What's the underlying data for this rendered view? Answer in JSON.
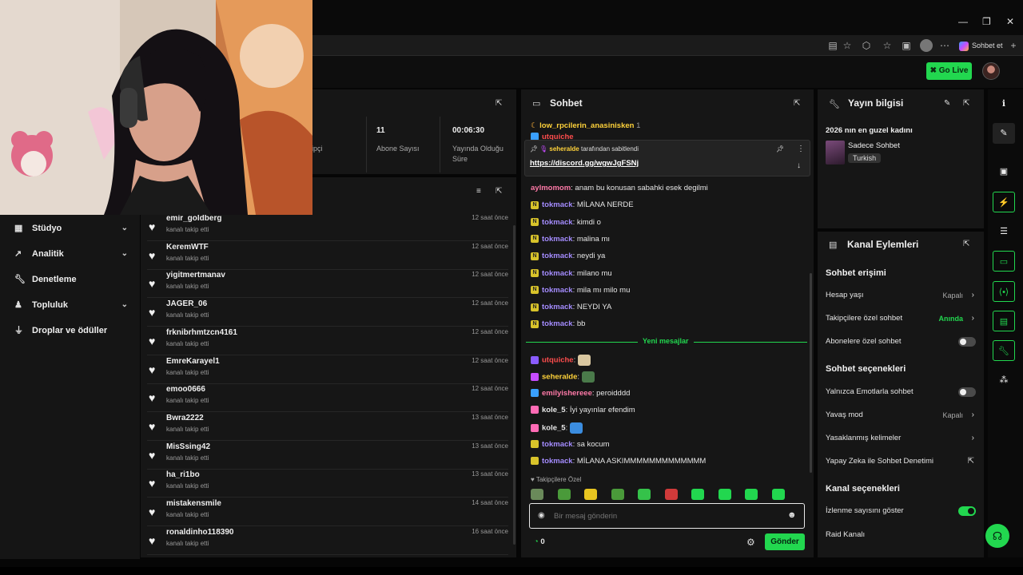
{
  "browser": {
    "window_controls": [
      "—",
      "❐",
      "✕"
    ],
    "copilot_label": "Sohbet et"
  },
  "topbar": {
    "go_live": "Go Live"
  },
  "nav": [
    {
      "label": "Stüdyo",
      "icon": "studio-icon",
      "expandable": true
    },
    {
      "label": "Analitik",
      "icon": "analytics-icon",
      "expandable": true
    },
    {
      "label": "Denetleme",
      "icon": "wrench-icon",
      "expandable": false
    },
    {
      "label": "Topluluk",
      "icon": "community-icon",
      "expandable": true
    },
    {
      "label": "Droplar ve ödüller",
      "icon": "drops-icon",
      "expandable": false
    }
  ],
  "stats": {
    "partial_label": "ipçi",
    "subs_value": "11",
    "subs_label": "Abone Sayısı",
    "time_value": "00:06:30",
    "time_label": "Yayında Olduğu Süre"
  },
  "followers": [
    {
      "name": "emir_goldberg",
      "action": "kanalı takip etti",
      "time": "12 saat önce"
    },
    {
      "name": "KeremWTF",
      "action": "kanalı takip etti",
      "time": "12 saat önce"
    },
    {
      "name": "yigitmertmanav",
      "action": "kanalı takip etti",
      "time": "12 saat önce"
    },
    {
      "name": "JAGER_06",
      "action": "kanalı takip etti",
      "time": "12 saat önce"
    },
    {
      "name": "frknibrhmtzcn4161",
      "action": "kanalı takip etti",
      "time": "12 saat önce"
    },
    {
      "name": "EmreKarayel1",
      "action": "kanalı takip etti",
      "time": "12 saat önce"
    },
    {
      "name": "emoo0666",
      "action": "kanalı takip etti",
      "time": "12 saat önce"
    },
    {
      "name": "Bwra2222",
      "action": "kanalı takip etti",
      "time": "13 saat önce"
    },
    {
      "name": "MisSsing42",
      "action": "kanalı takip etti",
      "time": "13 saat önce"
    },
    {
      "name": "ha_ri1bo",
      "action": "kanalı takip etti",
      "time": "13 saat önce"
    },
    {
      "name": "mistakensmile",
      "action": "kanalı takip etti",
      "time": "14 saat önce"
    },
    {
      "name": "ronaldinho118390",
      "action": "kanalı takip etti",
      "time": "16 saat önce"
    }
  ],
  "chat": {
    "title": "Sohbet",
    "top_user": "low_rpcilerin_anasinisken",
    "top_count": "1",
    "partial_user": "utquiche",
    "pinned_by_user": "seheralde",
    "pinned_by_text": "tarafından sabitlendi",
    "pinned_link": "https://discord.gg/wgwJgFSNj",
    "messages": [
      {
        "user": "aylmomom",
        "text": ": anam bu konusan sabahki esek degilmi",
        "color": "#ff7aa8",
        "badge": false
      },
      {
        "user": "tokmack",
        "text": ": MİLANA NERDE",
        "color": "#a48cff",
        "badge": true
      },
      {
        "user": "tokmack",
        "text": ": kimdi o",
        "color": "#a48cff",
        "badge": true
      },
      {
        "user": "tokmack",
        "text": ": malina mı",
        "color": "#a48cff",
        "badge": true
      },
      {
        "user": "tokmack",
        "text": ": neydi ya",
        "color": "#a48cff",
        "badge": true
      },
      {
        "user": "tokmack",
        "text": ": milano mu",
        "color": "#a48cff",
        "badge": true
      },
      {
        "user": "tokmack",
        "text": ": mila mı milo mu",
        "color": "#a48cff",
        "badge": true
      },
      {
        "user": "tokmack",
        "text": ": NEYDI YA",
        "color": "#a48cff",
        "badge": true
      },
      {
        "user": "tokmack",
        "text": ": bb",
        "color": "#a48cff",
        "badge": true
      }
    ],
    "new_messages": "Yeni mesajlar",
    "messages2": [
      {
        "user": "utquiche",
        "text": ":",
        "color": "#ff4d4d",
        "emote": "#d9c7a0"
      },
      {
        "user": "seheralde",
        "text": ":",
        "color": "#ffd23a",
        "emote": "#4a7a4a"
      },
      {
        "user": "emilyishereee",
        "text": ": peroidddd",
        "color": "#ff7aa8",
        "emote": ""
      },
      {
        "user": "kole_5",
        "text": ": İyi yayınlar efendim",
        "color": "#e6e6e6",
        "emote": ""
      },
      {
        "user": "kole_5",
        "text": ":",
        "color": "#e6e6e6",
        "emote": "#3b8de0"
      },
      {
        "user": "tokmack",
        "text": ": sa kocum",
        "color": "#a48cff",
        "emote": ""
      },
      {
        "user": "tokmack",
        "text": ": MİLANA ASKIMMMMMMMMMMMMM",
        "color": "#a48cff",
        "emote": ""
      }
    ],
    "follower_only": "Takipçilere Özel",
    "input_placeholder": "Bir mesaj gönderin",
    "count": "0",
    "send": "Gönder"
  },
  "streaminfo": {
    "title": "Yayın bilgisi",
    "stream_title": "2026 nın en guzel kadını",
    "category": "Sadece Sohbet",
    "language": "Turkish"
  },
  "actions": {
    "title": "Kanal Eylemleri",
    "chat_access": "Sohbet erişimi",
    "account_age": "Hesap yaşı",
    "account_age_val": "Kapalı",
    "followers_only": "Takipçilere özel sohbet",
    "followers_only_val": "Anında",
    "subs_only": "Abonelere özel sohbet",
    "chat_options": "Sohbet seçenekleri",
    "emote_only": "Yalnızca Emotlarla sohbet",
    "slow_mode": "Yavaş mod",
    "slow_mode_val": "Kapalı",
    "banned_words": "Yasaklanmış kelimeler",
    "ai_moderation": "Yapay Zeka ile Sohbet Denetimi",
    "channel_options": "Kanal seçenekleri",
    "show_viewers": "İzlenme sayısını göster",
    "raid_channel": "Raid Kanalı"
  },
  "colors": {
    "accent": "#22d74f",
    "panel": "#161616",
    "background": "#060606"
  }
}
